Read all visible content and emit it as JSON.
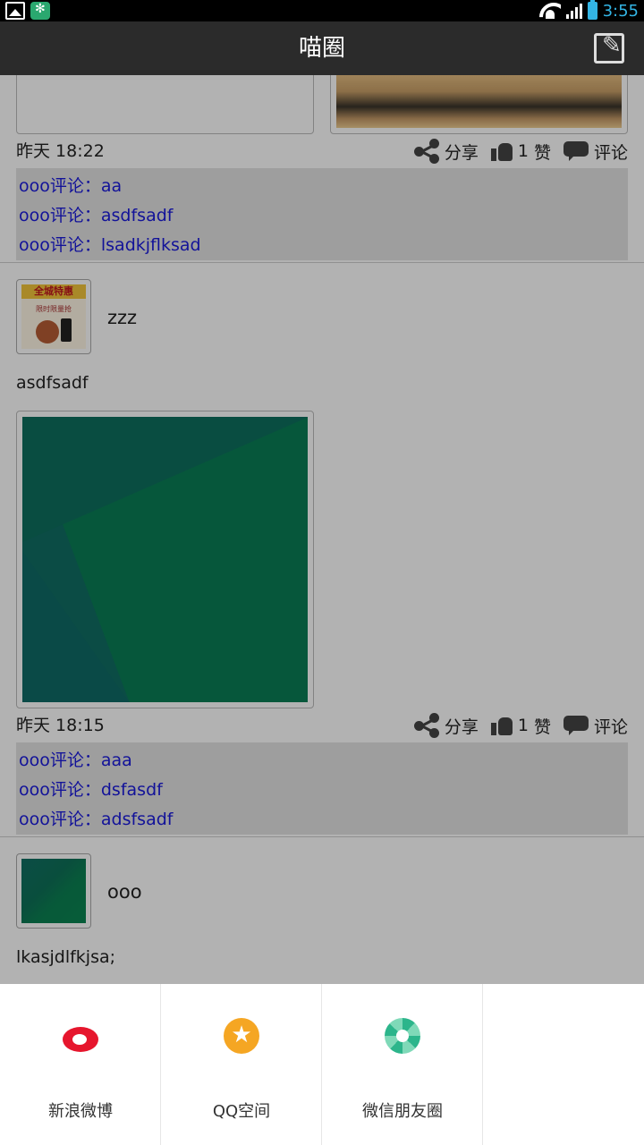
{
  "status_bar": {
    "time": "3:55"
  },
  "header": {
    "title": "喵圈"
  },
  "posts": [
    {
      "time": "昨天 18:22",
      "share_label": "分享",
      "like_count": "1",
      "like_label": "赞",
      "comment_label": "评论",
      "comments": [
        "ooo评论：aa",
        "ooo评论：asdfsadf",
        "ooo评论：lsadkjflksad"
      ]
    },
    {
      "username": "zzz",
      "content": "asdfsadf",
      "time": "昨天 18:15",
      "share_label": "分享",
      "like_count": "1",
      "like_label": "赞",
      "comment_label": "评论",
      "comments": [
        "ooo评论：aaa",
        "ooo评论：dsfasdf",
        "ooo评论：adsfsadf"
      ]
    },
    {
      "username": "ooo",
      "content": "lkasjdlfkjsa;"
    }
  ],
  "avatar_promo": {
    "band_text": "全城特惠",
    "sub_text": "限时限量抢"
  },
  "share_sheet": {
    "items": [
      {
        "label": "新浪微博",
        "icon": "weibo-icon"
      },
      {
        "label": "QQ空间",
        "icon": "qzone-icon"
      },
      {
        "label": "微信朋友圈",
        "icon": "moments-icon"
      }
    ]
  }
}
